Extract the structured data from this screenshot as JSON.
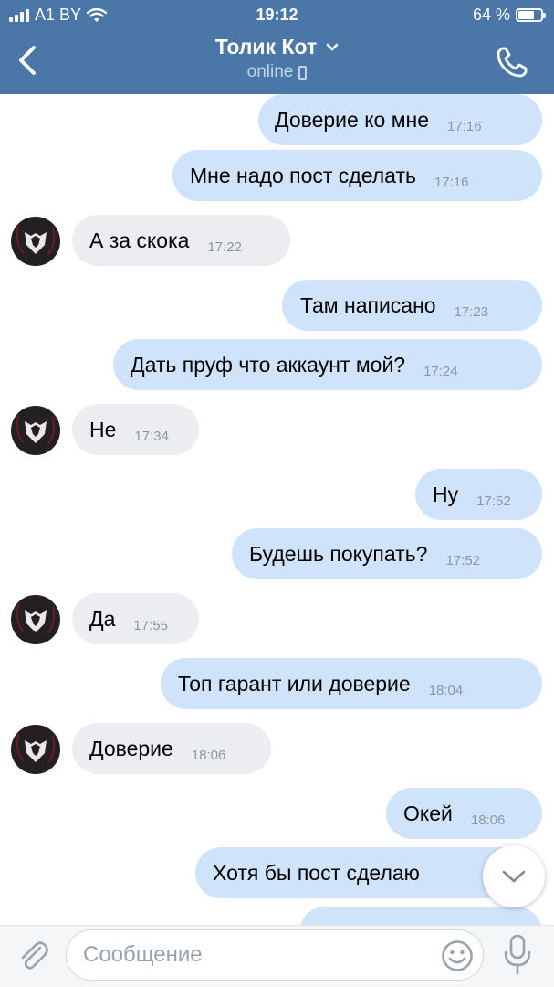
{
  "status_bar": {
    "carrier": "A1 BY",
    "time": "19:12",
    "battery_percent": "64 %",
    "battery_level": 0.64
  },
  "header": {
    "title": "Толик Кот",
    "subtitle": "online",
    "icons": {
      "back": "back-chevron-icon",
      "expand": "chevron-down-icon",
      "device": "mobile-device-icon",
      "call": "phone-icon"
    }
  },
  "messages": [
    {
      "dir": "out",
      "text": "Доверие ко мне",
      "time": "17:16"
    },
    {
      "dir": "out",
      "text": "Мне надо пост сделать",
      "time": "17:16"
    },
    {
      "dir": "in",
      "text": "А за скока",
      "time": "17:22"
    },
    {
      "dir": "out",
      "text": "Там написано",
      "time": "17:23"
    },
    {
      "dir": "out",
      "text": "Дать пруф что аккаунт мой?",
      "time": "17:24"
    },
    {
      "dir": "in",
      "text": "Не",
      "time": "17:34"
    },
    {
      "dir": "out",
      "text": "Ну",
      "time": "17:52"
    },
    {
      "dir": "out",
      "text": "Будешь покупать?",
      "time": "17:52"
    },
    {
      "dir": "in",
      "text": "Да",
      "time": "17:55"
    },
    {
      "dir": "out",
      "text": "Топ гарант или доверие",
      "time": "18:04"
    },
    {
      "dir": "in",
      "text": "Доверие",
      "time": "18:06"
    },
    {
      "dir": "out",
      "text": "Окей",
      "time": "18:06"
    },
    {
      "dir": "out",
      "text": "Хотя бы пост сделаю",
      "time": ""
    }
  ],
  "composer": {
    "placeholder": "Сообщение",
    "value": "",
    "icons": {
      "attach": "paperclip-icon",
      "emoji": "emoji-icon",
      "voice": "microphone-icon",
      "scroll": "chevron-down-icon"
    }
  },
  "colors": {
    "header_bg": "#4a76a8",
    "outgoing_bubble": "#cfe3fa",
    "incoming_bubble": "#ecedf0",
    "time_text": "#8c97a3",
    "avatar_accent": "#e8e8e8"
  }
}
